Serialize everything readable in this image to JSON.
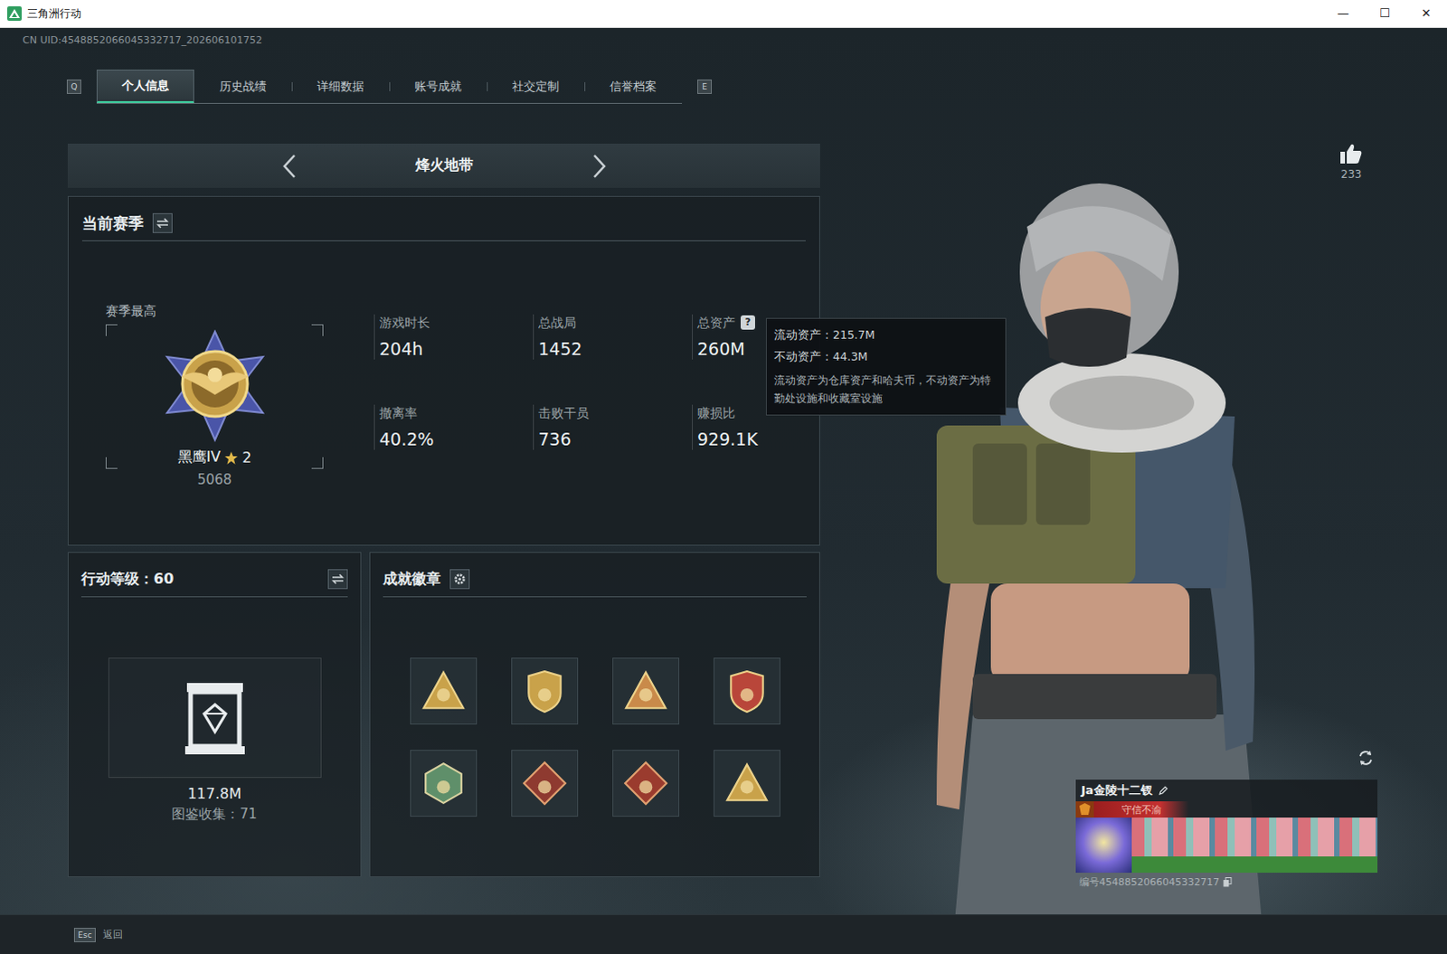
{
  "window": {
    "title": "三角洲行动",
    "controls": [
      "—",
      "☐",
      "✕"
    ]
  },
  "uid": "CN UID:4548852066045332717_202606101752",
  "tabs": {
    "prev_key": "Q",
    "next_key": "E",
    "items": [
      {
        "label": "个人信息",
        "selected": true
      },
      {
        "label": "历史战绩",
        "selected": false
      },
      {
        "label": "详细数据",
        "selected": false
      },
      {
        "label": "账号成就",
        "selected": false
      },
      {
        "label": "社交定制",
        "selected": false
      },
      {
        "label": "信誉档案",
        "selected": false
      }
    ]
  },
  "mode": {
    "label": "烽火地带"
  },
  "season": {
    "title": "当前赛季",
    "best_label": "赛季最高",
    "rank": {
      "name": "黑鹰IV",
      "stars": "2",
      "score": "5068"
    },
    "stats": [
      {
        "label": "游戏时长",
        "value": "204h"
      },
      {
        "label": "总战局",
        "value": "1452"
      },
      {
        "label": "总资产",
        "value": "260M",
        "help_icon": "?"
      },
      {
        "label": "撤离率",
        "value": "40.2%"
      },
      {
        "label": "击败干员",
        "value": "736"
      },
      {
        "label": "赚损比",
        "value": "929.1K"
      }
    ]
  },
  "tooltip": {
    "lines": [
      "流动资产：215.7M",
      "不动资产：44.3M"
    ],
    "note": "流动资产为仓库资产和哈夫币，不动资产为特勤处设施和收藏室设施"
  },
  "level": {
    "title": "行动等级：60",
    "value": "117.8M",
    "collection": "图鉴收集：71"
  },
  "achievements": {
    "title": "成就徽章",
    "badges": [
      {
        "kind": "triangle",
        "color": "#c9a24a"
      },
      {
        "kind": "shield",
        "color": "#c9a24a"
      },
      {
        "kind": "triangle",
        "color": "#c98a4a"
      },
      {
        "kind": "shield",
        "color": "#b9463a"
      },
      {
        "kind": "hexagon",
        "color": "#5f8f6a"
      },
      {
        "kind": "diamond",
        "color": "#8e3a30"
      },
      {
        "kind": "diamond",
        "color": "#9a3b2e"
      },
      {
        "kind": "triangle",
        "color": "#c9a24a"
      }
    ]
  },
  "likes": "233",
  "profile": {
    "name": "Ja金陵十二钗",
    "tag": "守信不渝",
    "id": "编号4548852066045332717"
  },
  "footer": {
    "key": "Esc",
    "label": "返回"
  }
}
